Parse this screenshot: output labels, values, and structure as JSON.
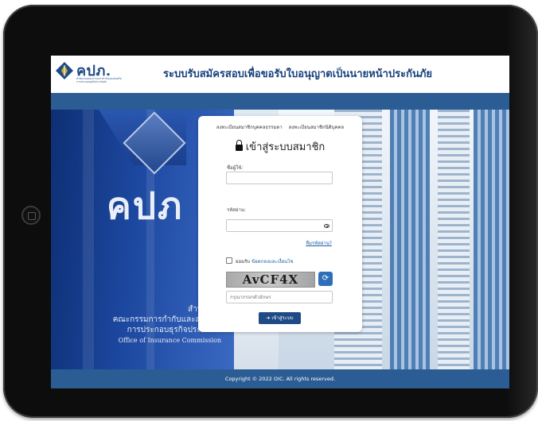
{
  "header": {
    "logo_text": "คปภ.",
    "logo_subtitle": "สำนักงานคณะกรรมการกำกับและส่งเสริม การประกอบธุรกิจประกันภัย",
    "site_title": "ระบบรับสมัครสอบเพื่อขอรับใบอนุญาตเป็นนายหน้าประกันภัย"
  },
  "background": {
    "building_logo_text": "คปภ",
    "caption_th_1": "สำนักงาน",
    "caption_th_2": "คณะกรรมการกำกับและส่งเสริม",
    "caption_th_3": "การประกอบธุรกิจประกันภัย",
    "caption_en": "Office of Insurance Commission"
  },
  "login": {
    "register_individual": "ลงทะเบียนสมาชิกบุคคลธรรมดา",
    "register_juristic": "ลงทะเบียนสมาชิกนิติบุคคล",
    "title": "เข้าสู่ระบบสมาชิก",
    "username_label": "ชื่อผู้ใช้:",
    "username_value": "",
    "password_label": "รหัสผ่าน:",
    "password_value": "",
    "forgot_password": "ลืมรหัสผ่าน?",
    "accept_prefix": "ยอมรับ",
    "accept_link": "ข้อตกลงและเงื่อนไข",
    "captcha_text": "AvCF4X",
    "captcha_placeholder": "กรุณากรอกตัวอักษร",
    "submit_label": "เข้าสู่ระบบ"
  },
  "footer": {
    "copyright": "Copyright © 2022 OIC. All rights reserved."
  },
  "colors": {
    "primary_blue": "#2b5d94",
    "title_blue": "#17417e",
    "button_blue": "#1f4a86"
  },
  "icons": {
    "lock": "lock-icon",
    "eye": "eye-icon",
    "refresh": "refresh-icon",
    "sign_in": "sign-in-icon"
  }
}
